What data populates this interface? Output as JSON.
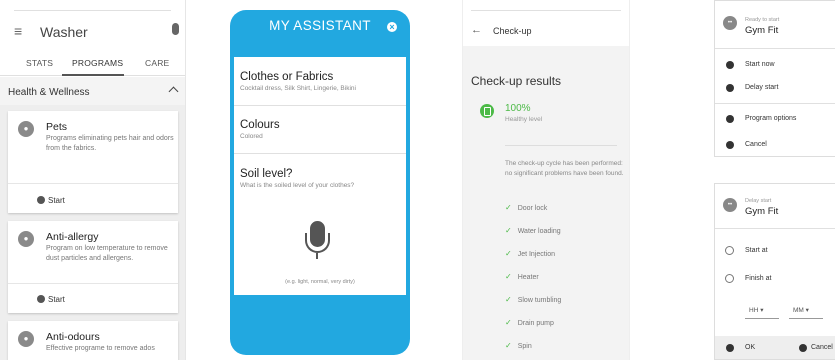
{
  "screen1": {
    "title": "Washer",
    "tabs": [
      "STATS",
      "PROGRAMS",
      "CARE"
    ],
    "section": "Health & Wellness",
    "cards": [
      {
        "title": "Pets",
        "desc": "Programs eliminating pets hair and odors from the fabrics.",
        "action": "Start"
      },
      {
        "title": "Anti-allergy",
        "desc": "Program on low temperature to remove dust particles and allergens.",
        "action": "Start"
      },
      {
        "title": "Anti-odours",
        "desc": "Effective programe to remove ados"
      }
    ]
  },
  "screen2": {
    "title": "MY ASSISTANT",
    "options": [
      {
        "title": "Clothes or Fabrics",
        "sub": "Cocktail dress, Silk Shirt, Lingerie, Bikini"
      },
      {
        "title": "Colours",
        "sub": "Colored"
      },
      {
        "title": "Soil level?",
        "sub": "What is the soiled level of your clothes?"
      }
    ],
    "hint": "(e.g. light, normal, very dirty)"
  },
  "screen3": {
    "title": "Check-up",
    "results_title": "Check-up results",
    "percent": "100%",
    "level": "Healthy level",
    "message": "The check-up cycle has been performed: no significant problems have been found.",
    "checks": [
      "Door lock",
      "Water loading",
      "Jet Injection",
      "Heater",
      "Slow tumbling",
      "Drain pump",
      "Spin"
    ]
  },
  "screen4": {
    "status": "Ready to start",
    "program": "Gym Fit",
    "actions": [
      "Start now",
      "Delay start",
      "Program options",
      "Cancel"
    ]
  },
  "screen5": {
    "status": "Delay start",
    "program": "Gym Fit",
    "options": [
      "Start at",
      "Finish at"
    ],
    "hh": "HH",
    "mm": "MM",
    "ok": "OK",
    "cancel": "Cancel"
  },
  "colors": {
    "assistant_blue": "#22a8e0",
    "success_green": "#4cba47"
  },
  "icons": [
    "menu-icon",
    "mic-icon",
    "close-icon",
    "back-arrow-icon",
    "check-icon",
    "play-icon"
  ]
}
